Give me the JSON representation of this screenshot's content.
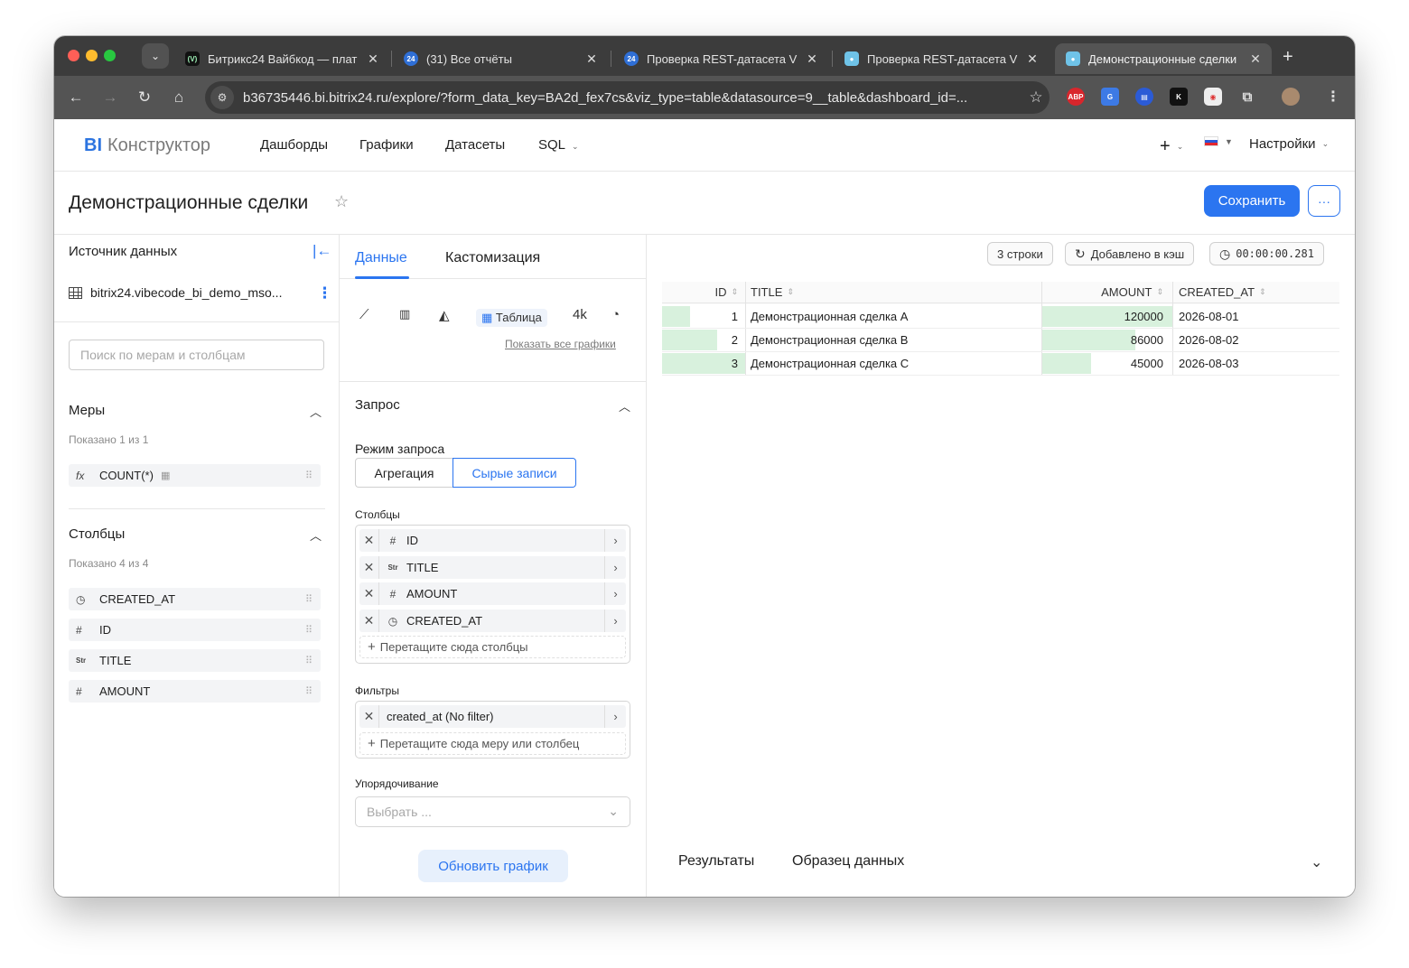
{
  "browser": {
    "tabs": [
      {
        "title": "Битрикс24 Вайбкод — плат",
        "icon": "vibecode-favicon"
      },
      {
        "title": "(31) Все отчёты",
        "icon": "bitrix24-favicon"
      },
      {
        "title": "Проверка REST-датасета V",
        "icon": "bitrix24-favicon"
      },
      {
        "title": "Проверка REST-датасета V",
        "icon": "bi-favicon"
      },
      {
        "title": "Демонстрационные сделки",
        "icon": "bi-favicon"
      }
    ],
    "url": "b36735446.bi.bitrix24.ru/explore/?form_data_key=BA2d_fex7cs&viz_type=table&datasource=9__table&dashboard_id=...",
    "extensions": [
      "ABP",
      "G",
      "K"
    ]
  },
  "nav": {
    "brand_bi": "BI",
    "brand_name": "Конструктор",
    "menu": [
      "Дашборды",
      "Графики",
      "Датасеты",
      "SQL"
    ],
    "plus": "+",
    "settings": "Настройки"
  },
  "header": {
    "title": "Демонстрационные сделки",
    "save": "Сохранить",
    "more": "···"
  },
  "left": {
    "source_label": "Источник данных",
    "dataset": "bitrix24.vibecode_bi_demo_mso...",
    "search_placeholder": "Поиск по мерам и столбцам",
    "measures_title": "Меры",
    "measures_count": "Показано 1 из 1",
    "measures": [
      {
        "name": "COUNT(*)",
        "icon": "fx"
      }
    ],
    "columns_title": "Столбцы",
    "columns_count": "Показано 4 из 4",
    "columns": [
      {
        "name": "CREATED_AT",
        "icon": "clock"
      },
      {
        "name": "ID",
        "icon": "#"
      },
      {
        "name": "TITLE",
        "icon": "Str"
      },
      {
        "name": "AMOUNT",
        "icon": "#"
      }
    ]
  },
  "middle": {
    "tab_data": "Данные",
    "tab_custom": "Кастомизация",
    "viz_table": "Таблица",
    "viz_4k": "4k",
    "show_all": "Показать все графики",
    "query_title": "Запрос",
    "query_mode_label": "Режим запроса",
    "mode_aggregate": "Агрегация",
    "mode_raw": "Сырые записи",
    "columns_label": "Столбцы",
    "selected_columns": [
      {
        "name": "ID",
        "icon": "#"
      },
      {
        "name": "TITLE",
        "icon": "Str"
      },
      {
        "name": "AMOUNT",
        "icon": "#"
      },
      {
        "name": "CREATED_AT",
        "icon": "clock"
      }
    ],
    "drop_columns": "Перетащите сюда столбцы",
    "filters_label": "Фильтры",
    "filter": "created_at (No filter)",
    "drop_filter": "Перетащите сюда меру или столбец",
    "order_label": "Упорядочивание",
    "order_placeholder": "Выбрать ...",
    "update": "Обновить график"
  },
  "right": {
    "rows_chip": "3 строки",
    "cache_chip": "Добавлено в кэш",
    "time_chip": "00:00:00.281",
    "headers": [
      "ID",
      "TITLE",
      "AMOUNT",
      "CREATED_AT"
    ],
    "rows": [
      {
        "id": "1",
        "title": "Демонстрационная сделка A",
        "amount": "120000",
        "created": "2026-08-01"
      },
      {
        "id": "2",
        "title": "Демонстрационная сделка B",
        "amount": "86000",
        "created": "2026-08-02"
      },
      {
        "id": "3",
        "title": "Демонстрационная сделка C",
        "amount": "45000",
        "created": "2026-08-03"
      }
    ],
    "bottom_results": "Результаты",
    "bottom_sample": "Образец данных",
    "bar_color": "#d8f1dd"
  },
  "colors": {
    "accent": "#2b75f0",
    "chrome": "#3c3c3c"
  }
}
